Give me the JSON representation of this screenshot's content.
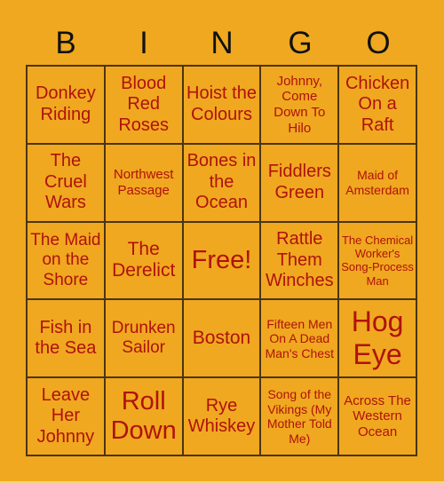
{
  "header": [
    "B",
    "I",
    "N",
    "G",
    "O"
  ],
  "cells": [
    {
      "text": "Donkey Riding",
      "size": "s20"
    },
    {
      "text": "Blood Red Roses",
      "size": "s20"
    },
    {
      "text": "Hoist the Colours",
      "size": "s20"
    },
    {
      "text": "Johnny, Come Down To Hilo",
      "size": "s15"
    },
    {
      "text": "Chicken On a Raft",
      "size": "s20"
    },
    {
      "text": "The Cruel Wars",
      "size": "s20"
    },
    {
      "text": "Northwest Passage",
      "size": "s15"
    },
    {
      "text": "Bones in the Ocean",
      "size": "s20"
    },
    {
      "text": "Fiddlers Green",
      "size": "s20"
    },
    {
      "text": "Maid of Amsterdam",
      "size": "s14"
    },
    {
      "text": "The Maid on the Shore",
      "size": "s18"
    },
    {
      "text": "The Derelict",
      "size": "s21"
    },
    {
      "text": "Free!",
      "size": "s28"
    },
    {
      "text": "Rattle Them Winches",
      "size": "s20"
    },
    {
      "text": "The Chemical Worker's Song-Process Man",
      "size": "s13"
    },
    {
      "text": "Fish in the Sea",
      "size": "s20"
    },
    {
      "text": "Drunken Sailor",
      "size": "s18"
    },
    {
      "text": "Boston",
      "size": "s21"
    },
    {
      "text": "Fifteen Men On A Dead Man's Chest",
      "size": "s14"
    },
    {
      "text": "Hog Eye",
      "size": "s32"
    },
    {
      "text": "Leave Her Johnny",
      "size": "s20"
    },
    {
      "text": "Roll Down",
      "size": "s28"
    },
    {
      "text": "Rye Whiskey",
      "size": "s20"
    },
    {
      "text": "Song of the Vikings (My Mother Told Me)",
      "size": "s14"
    },
    {
      "text": "Across The Western Ocean",
      "size": "s15"
    }
  ],
  "colors": {
    "background": "#efa820",
    "text": "#b0120c",
    "grid_line": "#4a3510"
  }
}
